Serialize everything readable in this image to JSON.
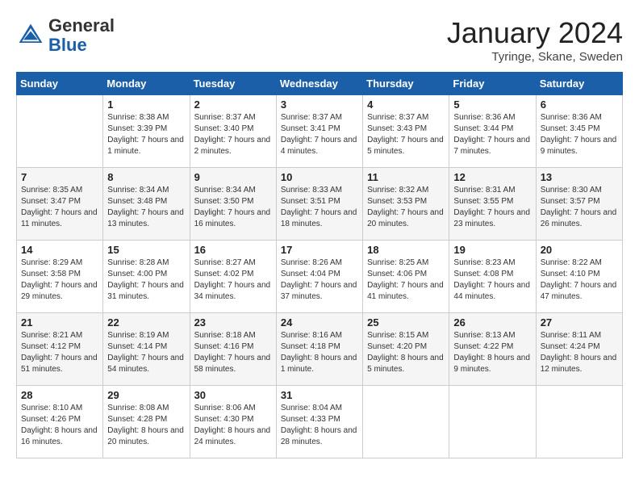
{
  "header": {
    "logo_general": "General",
    "logo_blue": "Blue",
    "month_title": "January 2024",
    "subtitle": "Tyringe, Skane, Sweden"
  },
  "days_of_week": [
    "Sunday",
    "Monday",
    "Tuesday",
    "Wednesday",
    "Thursday",
    "Friday",
    "Saturday"
  ],
  "weeks": [
    [
      {
        "day": null,
        "sunrise": null,
        "sunset": null,
        "daylight": null
      },
      {
        "day": "1",
        "sunrise": "Sunrise: 8:38 AM",
        "sunset": "Sunset: 3:39 PM",
        "daylight": "Daylight: 7 hours and 1 minute."
      },
      {
        "day": "2",
        "sunrise": "Sunrise: 8:37 AM",
        "sunset": "Sunset: 3:40 PM",
        "daylight": "Daylight: 7 hours and 2 minutes."
      },
      {
        "day": "3",
        "sunrise": "Sunrise: 8:37 AM",
        "sunset": "Sunset: 3:41 PM",
        "daylight": "Daylight: 7 hours and 4 minutes."
      },
      {
        "day": "4",
        "sunrise": "Sunrise: 8:37 AM",
        "sunset": "Sunset: 3:43 PM",
        "daylight": "Daylight: 7 hours and 5 minutes."
      },
      {
        "day": "5",
        "sunrise": "Sunrise: 8:36 AM",
        "sunset": "Sunset: 3:44 PM",
        "daylight": "Daylight: 7 hours and 7 minutes."
      },
      {
        "day": "6",
        "sunrise": "Sunrise: 8:36 AM",
        "sunset": "Sunset: 3:45 PM",
        "daylight": "Daylight: 7 hours and 9 minutes."
      }
    ],
    [
      {
        "day": "7",
        "sunrise": "Sunrise: 8:35 AM",
        "sunset": "Sunset: 3:47 PM",
        "daylight": "Daylight: 7 hours and 11 minutes."
      },
      {
        "day": "8",
        "sunrise": "Sunrise: 8:34 AM",
        "sunset": "Sunset: 3:48 PM",
        "daylight": "Daylight: 7 hours and 13 minutes."
      },
      {
        "day": "9",
        "sunrise": "Sunrise: 8:34 AM",
        "sunset": "Sunset: 3:50 PM",
        "daylight": "Daylight: 7 hours and 16 minutes."
      },
      {
        "day": "10",
        "sunrise": "Sunrise: 8:33 AM",
        "sunset": "Sunset: 3:51 PM",
        "daylight": "Daylight: 7 hours and 18 minutes."
      },
      {
        "day": "11",
        "sunrise": "Sunrise: 8:32 AM",
        "sunset": "Sunset: 3:53 PM",
        "daylight": "Daylight: 7 hours and 20 minutes."
      },
      {
        "day": "12",
        "sunrise": "Sunrise: 8:31 AM",
        "sunset": "Sunset: 3:55 PM",
        "daylight": "Daylight: 7 hours and 23 minutes."
      },
      {
        "day": "13",
        "sunrise": "Sunrise: 8:30 AM",
        "sunset": "Sunset: 3:57 PM",
        "daylight": "Daylight: 7 hours and 26 minutes."
      }
    ],
    [
      {
        "day": "14",
        "sunrise": "Sunrise: 8:29 AM",
        "sunset": "Sunset: 3:58 PM",
        "daylight": "Daylight: 7 hours and 29 minutes."
      },
      {
        "day": "15",
        "sunrise": "Sunrise: 8:28 AM",
        "sunset": "Sunset: 4:00 PM",
        "daylight": "Daylight: 7 hours and 31 minutes."
      },
      {
        "day": "16",
        "sunrise": "Sunrise: 8:27 AM",
        "sunset": "Sunset: 4:02 PM",
        "daylight": "Daylight: 7 hours and 34 minutes."
      },
      {
        "day": "17",
        "sunrise": "Sunrise: 8:26 AM",
        "sunset": "Sunset: 4:04 PM",
        "daylight": "Daylight: 7 hours and 37 minutes."
      },
      {
        "day": "18",
        "sunrise": "Sunrise: 8:25 AM",
        "sunset": "Sunset: 4:06 PM",
        "daylight": "Daylight: 7 hours and 41 minutes."
      },
      {
        "day": "19",
        "sunrise": "Sunrise: 8:23 AM",
        "sunset": "Sunset: 4:08 PM",
        "daylight": "Daylight: 7 hours and 44 minutes."
      },
      {
        "day": "20",
        "sunrise": "Sunrise: 8:22 AM",
        "sunset": "Sunset: 4:10 PM",
        "daylight": "Daylight: 7 hours and 47 minutes."
      }
    ],
    [
      {
        "day": "21",
        "sunrise": "Sunrise: 8:21 AM",
        "sunset": "Sunset: 4:12 PM",
        "daylight": "Daylight: 7 hours and 51 minutes."
      },
      {
        "day": "22",
        "sunrise": "Sunrise: 8:19 AM",
        "sunset": "Sunset: 4:14 PM",
        "daylight": "Daylight: 7 hours and 54 minutes."
      },
      {
        "day": "23",
        "sunrise": "Sunrise: 8:18 AM",
        "sunset": "Sunset: 4:16 PM",
        "daylight": "Daylight: 7 hours and 58 minutes."
      },
      {
        "day": "24",
        "sunrise": "Sunrise: 8:16 AM",
        "sunset": "Sunset: 4:18 PM",
        "daylight": "Daylight: 8 hours and 1 minute."
      },
      {
        "day": "25",
        "sunrise": "Sunrise: 8:15 AM",
        "sunset": "Sunset: 4:20 PM",
        "daylight": "Daylight: 8 hours and 5 minutes."
      },
      {
        "day": "26",
        "sunrise": "Sunrise: 8:13 AM",
        "sunset": "Sunset: 4:22 PM",
        "daylight": "Daylight: 8 hours and 9 minutes."
      },
      {
        "day": "27",
        "sunrise": "Sunrise: 8:11 AM",
        "sunset": "Sunset: 4:24 PM",
        "daylight": "Daylight: 8 hours and 12 minutes."
      }
    ],
    [
      {
        "day": "28",
        "sunrise": "Sunrise: 8:10 AM",
        "sunset": "Sunset: 4:26 PM",
        "daylight": "Daylight: 8 hours and 16 minutes."
      },
      {
        "day": "29",
        "sunrise": "Sunrise: 8:08 AM",
        "sunset": "Sunset: 4:28 PM",
        "daylight": "Daylight: 8 hours and 20 minutes."
      },
      {
        "day": "30",
        "sunrise": "Sunrise: 8:06 AM",
        "sunset": "Sunset: 4:30 PM",
        "daylight": "Daylight: 8 hours and 24 minutes."
      },
      {
        "day": "31",
        "sunrise": "Sunrise: 8:04 AM",
        "sunset": "Sunset: 4:33 PM",
        "daylight": "Daylight: 8 hours and 28 minutes."
      },
      {
        "day": null,
        "sunrise": null,
        "sunset": null,
        "daylight": null
      },
      {
        "day": null,
        "sunrise": null,
        "sunset": null,
        "daylight": null
      },
      {
        "day": null,
        "sunrise": null,
        "sunset": null,
        "daylight": null
      }
    ]
  ]
}
